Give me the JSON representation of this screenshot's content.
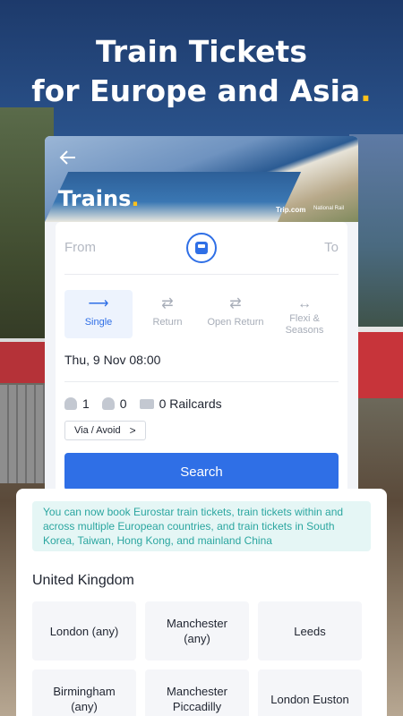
{
  "headline": {
    "line1": "Train Tickets",
    "line2": "for Europe and Asia",
    "dot": "."
  },
  "hero": {
    "back_icon": "arrow-left-icon",
    "title": "Trains",
    "title_dot": ".",
    "brand": "Trip.com",
    "brand2": "National Rail"
  },
  "form": {
    "from_placeholder": "From",
    "to_placeholder": "To",
    "swap_icon": "train-swap-icon",
    "trip_types": [
      {
        "label": "Single",
        "icon": "arrow-right-icon",
        "active": true
      },
      {
        "label": "Return",
        "icon": "double-arrow-icon",
        "active": false
      },
      {
        "label": "Open Return",
        "icon": "double-arrow-icon",
        "active": false
      },
      {
        "label": "Flexi & Seasons",
        "icon": "bidirectional-arrow-icon",
        "active": false
      }
    ],
    "date": "Thu, 9 Nov 08:00",
    "adults": "1",
    "children": "0",
    "railcards": "0 Railcards",
    "via_label": "Via / Avoid",
    "via_chevron": ">",
    "search_label": "Search"
  },
  "sheet": {
    "notice": "You can now book Eurostar train tickets, train tickets within and across multiple European countries, and train tickets in South Korea, Taiwan, Hong Kong, and mainland China",
    "country": "United Kingdom",
    "cities": [
      "London (any)",
      "Manchester (any)",
      "Leeds",
      "Birmingham (any)",
      "Manchester Piccadilly",
      "London Euston"
    ]
  },
  "colors": {
    "accent": "#2f6fe6",
    "brand_dot": "#ffc21a",
    "notice_text": "#2ba6a0",
    "notice_bg": "#e5f6f5"
  }
}
